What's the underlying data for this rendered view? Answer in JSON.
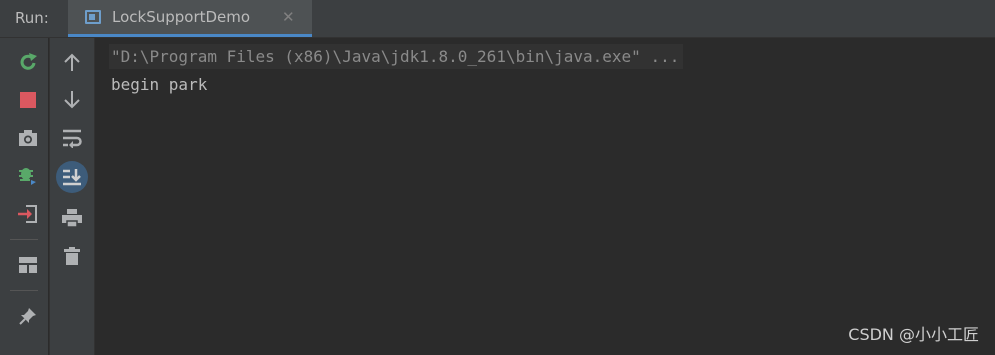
{
  "header": {
    "run_label": "Run:",
    "tab": {
      "title": "LockSupportDemo",
      "close": "✕"
    }
  },
  "toolbar_primary": [
    {
      "name": "rerun-icon",
      "tooltip": "Rerun"
    },
    {
      "name": "stop-icon",
      "tooltip": "Stop"
    },
    {
      "name": "camera-icon",
      "tooltip": "Dump Threads"
    },
    {
      "name": "debug-icon",
      "tooltip": "Restart in Debug"
    },
    {
      "name": "login-icon",
      "tooltip": "Exit"
    },
    {
      "name": "layout-icon",
      "tooltip": "Restore Layout"
    },
    {
      "name": "pin-icon",
      "tooltip": "Pin Tab"
    }
  ],
  "toolbar_secondary": [
    {
      "name": "arrow-up-icon",
      "tooltip": "Up"
    },
    {
      "name": "arrow-down-icon",
      "tooltip": "Down"
    },
    {
      "name": "soft-wrap-icon",
      "tooltip": "Soft-Wrap"
    },
    {
      "name": "scroll-to-end-icon",
      "tooltip": "Scroll to End"
    },
    {
      "name": "print-icon",
      "tooltip": "Print"
    },
    {
      "name": "trash-icon",
      "tooltip": "Clear All"
    }
  ],
  "console": {
    "command_line": "\"D:\\Program Files (x86)\\Java\\jdk1.8.0_261\\bin\\java.exe\" ...",
    "output_lines": [
      "begin park"
    ]
  },
  "watermark": "CSDN @小小工匠",
  "colors": {
    "background": "#2b2b2b",
    "panel": "#3c3f41",
    "tab_active": "#4e5254",
    "accent_blue": "#4a88c7",
    "green": "#59a869",
    "red": "#db5860",
    "icon_gray": "#afb1b3"
  }
}
